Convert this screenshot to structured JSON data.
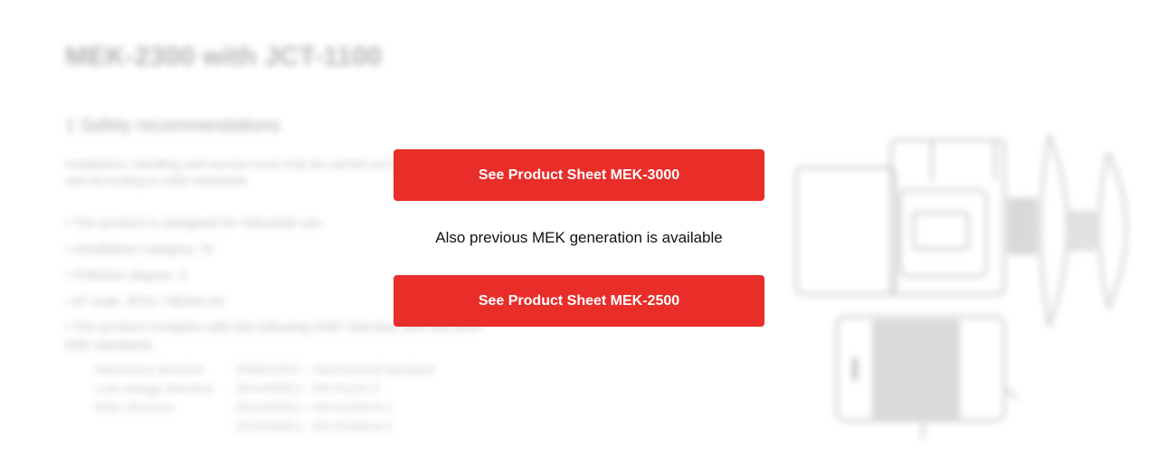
{
  "background": {
    "title": "MEK-2300 with JCT-1100",
    "section_heading": "1 Safety recommendations",
    "paragraph": "Installation, handling and service must only be carried out by technical personnel and according to valid standards",
    "list_items": [
      "• The product is designed for industrial use",
      "• Installation category: III",
      "• Pollution degree: 2",
      "• IP code: IP20 / NEMA 4X",
      "• The product complies with the following EMC directive and low-level EMI standards"
    ],
    "table_rows": [
      [
        "Machinery directive",
        "2006/42/EC - Harmonised standard"
      ],
      [
        "Low voltage directive",
        "2014/35/EU - EN 61131-2"
      ],
      [
        "EMC directive",
        "2014/30/EU - EN 61000-6-2"
      ],
      [
        "",
        "2014/30/EU - EN 61000-6-4"
      ]
    ]
  },
  "modal": {
    "primary_button_label": "See Product Sheet MEK-3000",
    "info_text": "Also previous MEK generation is available",
    "secondary_button_label": "See Product Sheet MEK-2500"
  },
  "colors": {
    "accent": "#e92d29",
    "button_text": "#ffffff",
    "info_text": "#111111"
  }
}
